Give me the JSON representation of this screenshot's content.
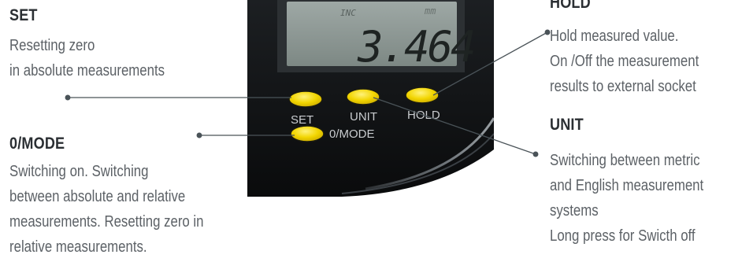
{
  "display": {
    "indicator_left": "INC",
    "indicator_right": "mm",
    "reading": "3.464"
  },
  "buttons": {
    "set": "SET",
    "unit": "UNIT",
    "hold": "HOLD",
    "mode": "0/MODE"
  },
  "callouts": {
    "set": {
      "title": "SET",
      "lines": [
        "Resetting zero",
        "in absolute measurements"
      ]
    },
    "mode": {
      "title": "0/MODE",
      "lines": [
        "Switching on.  Switching",
        "between absolute and relative",
        "measurements. Resetting zero in",
        "relative measurements."
      ]
    },
    "hold": {
      "title": "HOLD",
      "lines": [
        "Hold measured value.",
        "On /Off the measurement",
        "results to external socket"
      ]
    },
    "unit": {
      "title": "UNIT",
      "lines": [
        "Switching between metric",
        "and English measurement",
        "systems",
        "Long press for Swicth off"
      ]
    }
  },
  "colors": {
    "button_yellow": "#f2d500",
    "leader_line": "#4a5358",
    "lcd": "#8e9995"
  }
}
